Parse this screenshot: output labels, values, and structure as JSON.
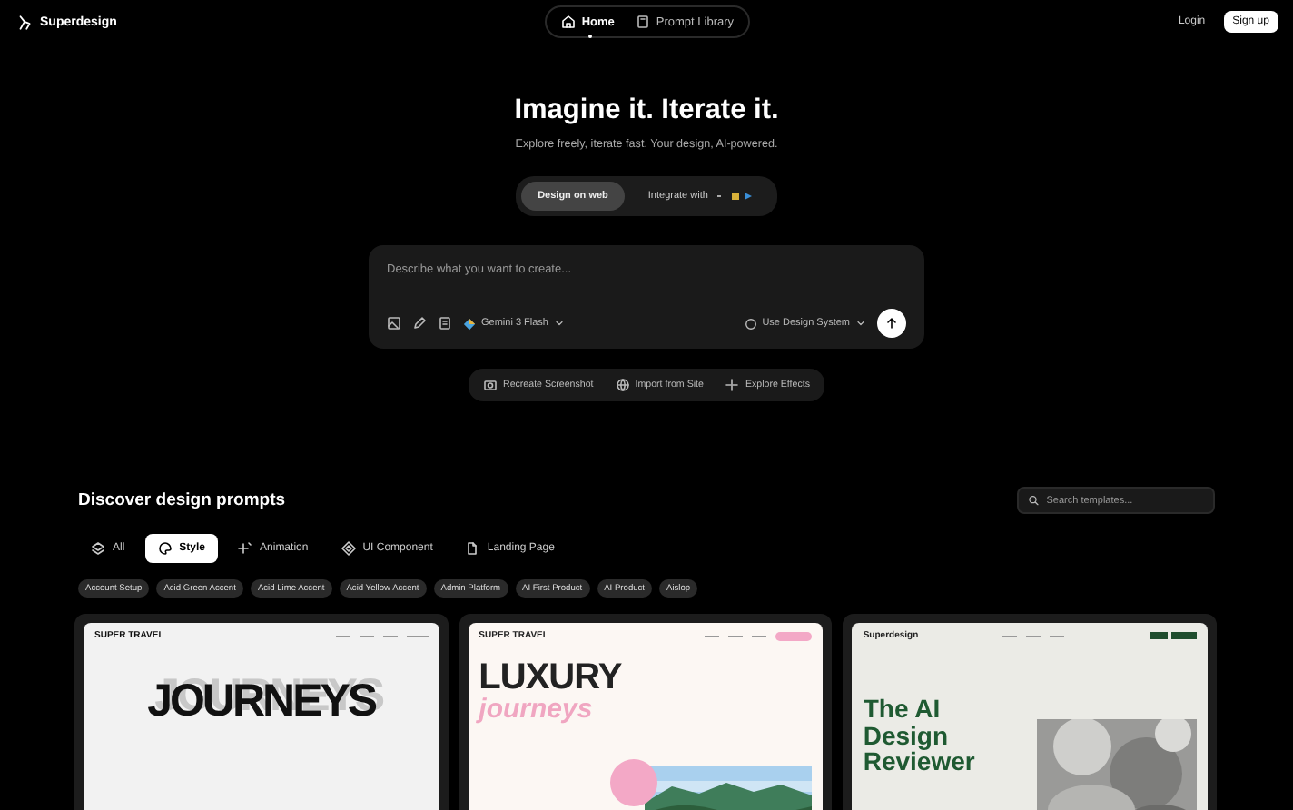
{
  "header": {
    "brand": "Superdesign",
    "nav": [
      {
        "label": "Home",
        "selected": true
      },
      {
        "label": "Prompt Library",
        "selected": false
      }
    ],
    "login": "Login",
    "signup": "Sign up"
  },
  "hero": {
    "title": "Imagine it. Iterate it.",
    "subtitle": "Explore freely, iterate fast. Your design, AI-powered.",
    "modes": [
      {
        "label": "Design on web",
        "selected": true
      },
      {
        "label": "Integrate with",
        "selected": false
      }
    ]
  },
  "prompt": {
    "placeholder": "Describe what you want to create...",
    "model": "Gemini 3 Flash",
    "design_system": "Use Design System"
  },
  "actions": [
    "Recreate Screenshot",
    "Import from Site",
    "Explore Effects"
  ],
  "discover": {
    "title": "Discover design prompts",
    "search": {
      "placeholder": "Search templates..."
    },
    "categories": [
      {
        "label": "All",
        "selected": false
      },
      {
        "label": "Style",
        "selected": true
      },
      {
        "label": "Animation",
        "selected": false
      },
      {
        "label": "UI Component",
        "selected": false
      },
      {
        "label": "Landing Page",
        "selected": false
      }
    ],
    "tags": [
      "Account Setup",
      "Acid Green Accent",
      "Acid Lime Accent",
      "Acid Yellow Accent",
      "Admin Platform",
      "AI First Product",
      "AI Product",
      "Aislop"
    ],
    "cards": [
      {
        "kind": "journeys",
        "brand": "SUPER TRAVEL",
        "headline": "JOURNEYS"
      },
      {
        "kind": "luxury",
        "brand": "SUPER TRAVEL",
        "headline": "LUXURY",
        "accent": "journeys"
      },
      {
        "kind": "reviewer",
        "brand": "Superdesign",
        "headline": "The AI Design Reviewer"
      }
    ]
  }
}
